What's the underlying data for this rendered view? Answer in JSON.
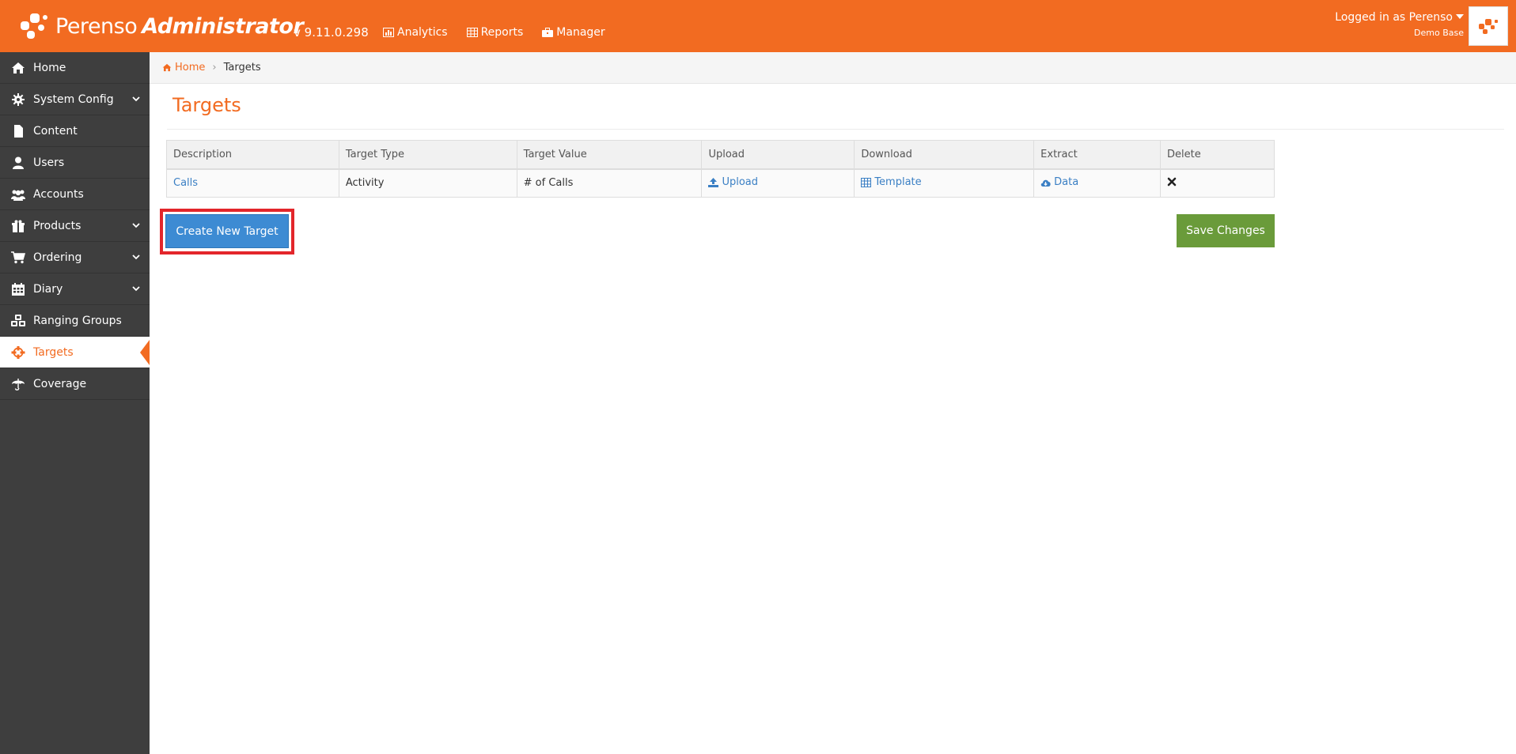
{
  "header": {
    "brand_light": "Perenso",
    "brand_bold": "Administrator",
    "version": "v 9.11.0.298",
    "nav": [
      {
        "label": "Analytics",
        "icon": "chart-icon"
      },
      {
        "label": "Reports",
        "icon": "table-icon"
      },
      {
        "label": "Manager",
        "icon": "briefcase-icon"
      }
    ],
    "user": {
      "logged_in": "Logged in as Perenso",
      "database": "Demo Base"
    },
    "colors": {
      "brand": "#f26b21"
    }
  },
  "sidebar": {
    "items": [
      {
        "label": "Home",
        "icon": "home-icon"
      },
      {
        "label": "System Config",
        "icon": "gear-icon",
        "expandable": true
      },
      {
        "label": "Content",
        "icon": "file-icon"
      },
      {
        "label": "Users",
        "icon": "user-icon"
      },
      {
        "label": "Accounts",
        "icon": "users-icon"
      },
      {
        "label": "Products",
        "icon": "gift-icon",
        "expandable": true
      },
      {
        "label": "Ordering",
        "icon": "cart-icon",
        "expandable": true
      },
      {
        "label": "Diary",
        "icon": "calendar-icon",
        "expandable": true
      },
      {
        "label": "Ranging Groups",
        "icon": "cubes-icon"
      },
      {
        "label": "Targets",
        "icon": "crosshairs-icon",
        "active": true
      },
      {
        "label": "Coverage",
        "icon": "umbrella-icon"
      }
    ]
  },
  "breadcrumb": {
    "home": "Home",
    "current": "Targets"
  },
  "page": {
    "title": "Targets"
  },
  "table": {
    "headers": [
      "Description",
      "Target Type",
      "Target Value",
      "Upload",
      "Download",
      "Extract",
      "Delete"
    ],
    "rows": [
      {
        "description": "Calls",
        "target_type": "Activity",
        "target_value": "# of Calls",
        "upload": "Upload",
        "download": "Template",
        "extract": "Data",
        "delete_icon": "close-icon"
      }
    ]
  },
  "actions": {
    "create": "Create New Target",
    "save": "Save Changes",
    "colors": {
      "create": "#3d8bd3",
      "save": "#6a9b3a",
      "highlight": "#e3262b"
    }
  }
}
